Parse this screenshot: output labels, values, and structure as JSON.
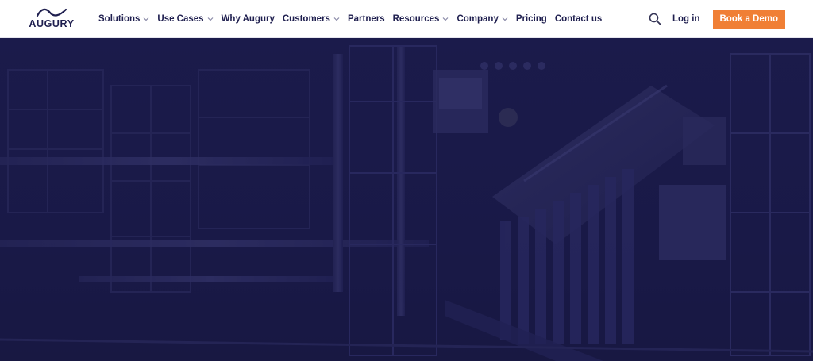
{
  "brand": {
    "name": "AUGURY",
    "color": "#1f1f4f"
  },
  "nav": {
    "items": [
      {
        "label": "Solutions",
        "dropdown": true
      },
      {
        "label": "Use Cases",
        "dropdown": true
      },
      {
        "label": "Why Augury",
        "dropdown": false
      },
      {
        "label": "Customers",
        "dropdown": true
      },
      {
        "label": "Partners",
        "dropdown": false
      },
      {
        "label": "Resources",
        "dropdown": true
      },
      {
        "label": "Company",
        "dropdown": true
      },
      {
        "label": "Pricing",
        "dropdown": false
      },
      {
        "label": "Contact us",
        "dropdown": false
      }
    ]
  },
  "header_right": {
    "search_icon": "search-icon",
    "login_label": "Log in",
    "cta_label": "Book a Demo",
    "cta_color": "#f07f35"
  },
  "hero": {
    "background_color": "#1a1a48",
    "image": "industrial-plant-machinery"
  }
}
